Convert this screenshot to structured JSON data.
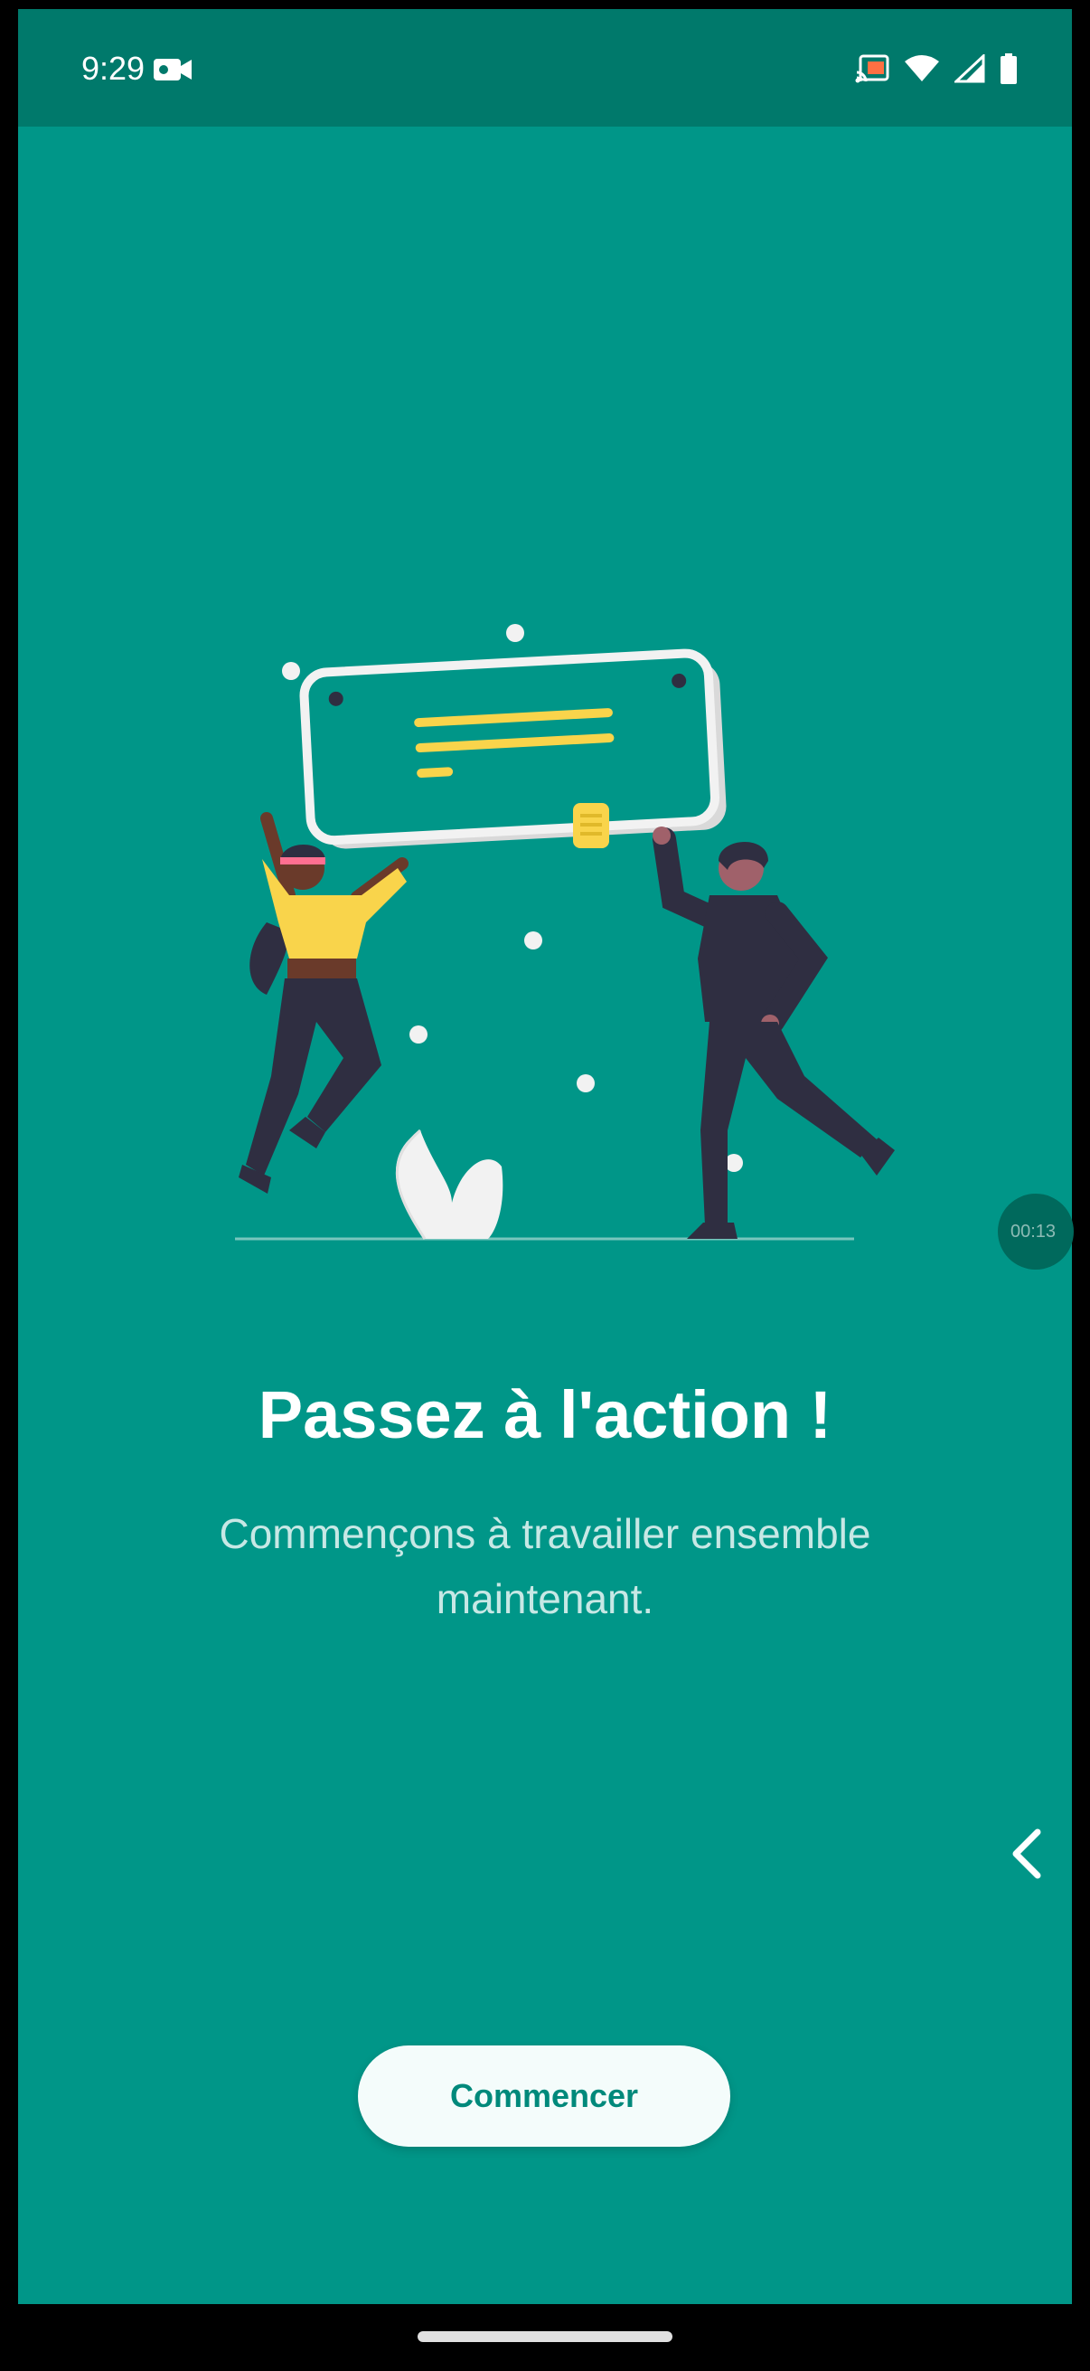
{
  "status_bar": {
    "time": "9:29",
    "icons": [
      "video-record-icon",
      "cast-icon",
      "wifi-icon",
      "signal-icon",
      "battery-icon"
    ]
  },
  "colors": {
    "background": "#009688",
    "status_bar": "#00796b",
    "button_bg": "#f4fcfb",
    "button_text": "#00897b",
    "accent_yellow": "#f9d44b",
    "figure_dark": "#2f2e41"
  },
  "onboarding": {
    "illustration": "two-people-holding-message-card",
    "title": "Passez à l'action !",
    "subtitle": "Commençons à travailler ensemble maintenant.",
    "button_label": "Commencer"
  },
  "overlay": {
    "timer": "00:13"
  }
}
